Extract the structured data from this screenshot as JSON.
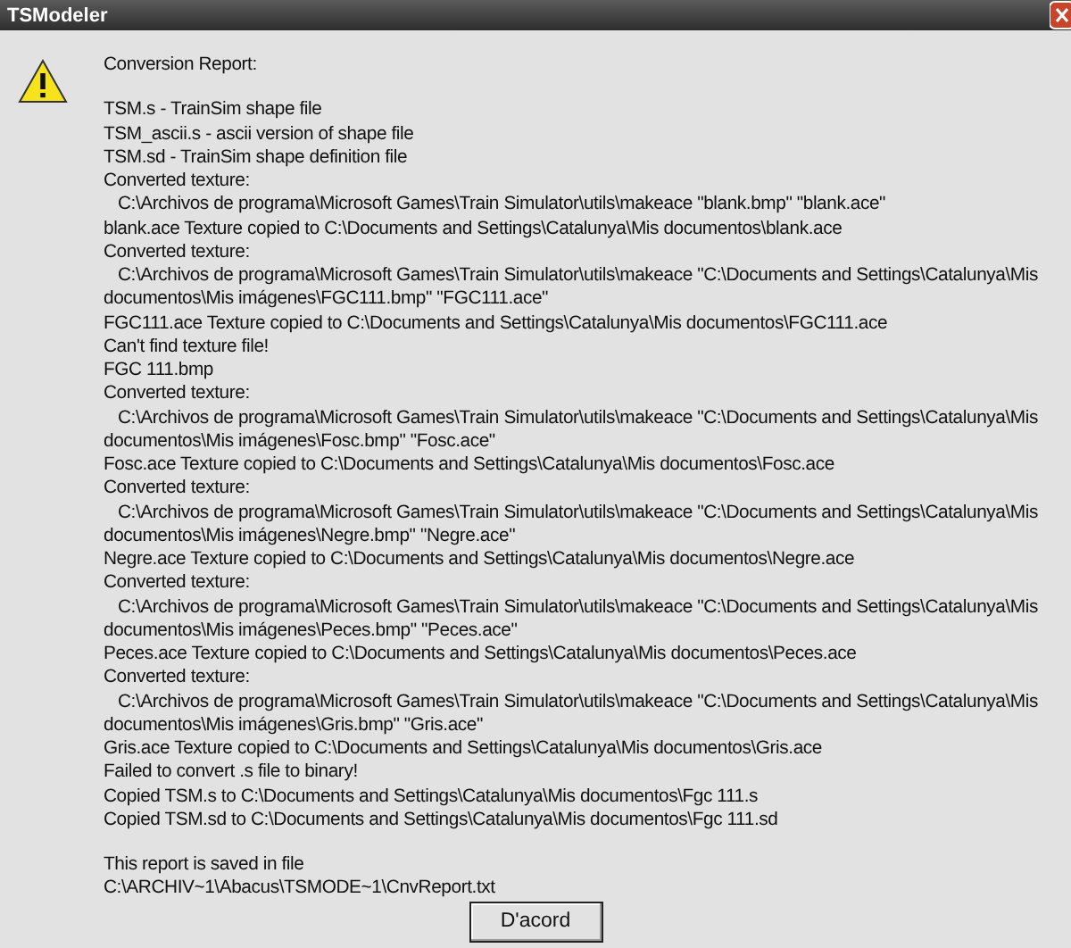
{
  "window": {
    "title": "TSModeler"
  },
  "report": {
    "heading": "Conversion Report:",
    "lines": [
      {
        "kind": "plain",
        "text": "TSM.s - TrainSim shape file"
      },
      {
        "kind": "plain",
        "text": "TSM_ascii.s - ascii version of shape file"
      },
      {
        "kind": "plain",
        "text": "TSM.sd - TrainSim shape definition file"
      },
      {
        "kind": "plain",
        "text": "Converted texture:"
      },
      {
        "kind": "indented",
        "text": "C:\\Archivos de programa\\Microsoft Games\\Train Simulator\\utils\\makeace \"blank.bmp\" \"blank.ace\""
      },
      {
        "kind": "plain",
        "text": "blank.ace Texture copied to C:\\Documents and Settings\\Catalunya\\Mis documentos\\blank.ace"
      },
      {
        "kind": "plain",
        "text": "Converted texture:"
      },
      {
        "kind": "indented",
        "text": "C:\\Archivos de programa\\Microsoft Games\\Train Simulator\\utils\\makeace \"C:\\Documents and Settings\\Catalunya\\Mis"
      },
      {
        "kind": "plain",
        "text": "documentos\\Mis imágenes\\FGC111.bmp\" \"FGC111.ace\""
      },
      {
        "kind": "plain",
        "text": "FGC111.ace Texture copied to C:\\Documents and Settings\\Catalunya\\Mis documentos\\FGC111.ace"
      },
      {
        "kind": "plain",
        "text": "Can't find texture file!"
      },
      {
        "kind": "plain",
        "text": "FGC 111.bmp"
      },
      {
        "kind": "plain",
        "text": "Converted texture:"
      },
      {
        "kind": "indented",
        "text": "C:\\Archivos de programa\\Microsoft Games\\Train Simulator\\utils\\makeace \"C:\\Documents and Settings\\Catalunya\\Mis"
      },
      {
        "kind": "plain",
        "text": "documentos\\Mis imágenes\\Fosc.bmp\" \"Fosc.ace\""
      },
      {
        "kind": "plain",
        "text": "Fosc.ace Texture copied to C:\\Documents and Settings\\Catalunya\\Mis documentos\\Fosc.ace"
      },
      {
        "kind": "plain",
        "text": "Converted texture:"
      },
      {
        "kind": "indented",
        "text": "C:\\Archivos de programa\\Microsoft Games\\Train Simulator\\utils\\makeace \"C:\\Documents and Settings\\Catalunya\\Mis"
      },
      {
        "kind": "plain",
        "text": "documentos\\Mis imágenes\\Negre.bmp\" \"Negre.ace\""
      },
      {
        "kind": "plain",
        "text": "Negre.ace Texture copied to C:\\Documents and Settings\\Catalunya\\Mis documentos\\Negre.ace"
      },
      {
        "kind": "plain",
        "text": "Converted texture:"
      },
      {
        "kind": "indented",
        "text": "C:\\Archivos de programa\\Microsoft Games\\Train Simulator\\utils\\makeace \"C:\\Documents and Settings\\Catalunya\\Mis"
      },
      {
        "kind": "plain",
        "text": "documentos\\Mis imágenes\\Peces.bmp\" \"Peces.ace\""
      },
      {
        "kind": "plain",
        "text": "Peces.ace Texture copied to C:\\Documents and Settings\\Catalunya\\Mis documentos\\Peces.ace"
      },
      {
        "kind": "plain",
        "text": "Converted texture:"
      },
      {
        "kind": "indented",
        "text": "C:\\Archivos de programa\\Microsoft Games\\Train Simulator\\utils\\makeace \"C:\\Documents and Settings\\Catalunya\\Mis"
      },
      {
        "kind": "plain",
        "text": "documentos\\Mis imágenes\\Gris.bmp\" \"Gris.ace\""
      },
      {
        "kind": "plain",
        "text": "Gris.ace Texture copied to C:\\Documents and Settings\\Catalunya\\Mis documentos\\Gris.ace"
      },
      {
        "kind": "plain",
        "text": "Failed to convert .s file to binary!"
      },
      {
        "kind": "plain",
        "text": "Copied TSM.s to C:\\Documents and Settings\\Catalunya\\Mis documentos\\Fgc 111.s"
      },
      {
        "kind": "plain",
        "text": "Copied TSM.sd to C:\\Documents and Settings\\Catalunya\\Mis documentos\\Fgc 111.sd"
      }
    ],
    "footer": [
      "This report is saved in file",
      "C:\\ARCHIV~1\\Abacus\\TSMODE~1\\CnvReport.txt"
    ]
  },
  "buttons": [
    "D'acord"
  ]
}
